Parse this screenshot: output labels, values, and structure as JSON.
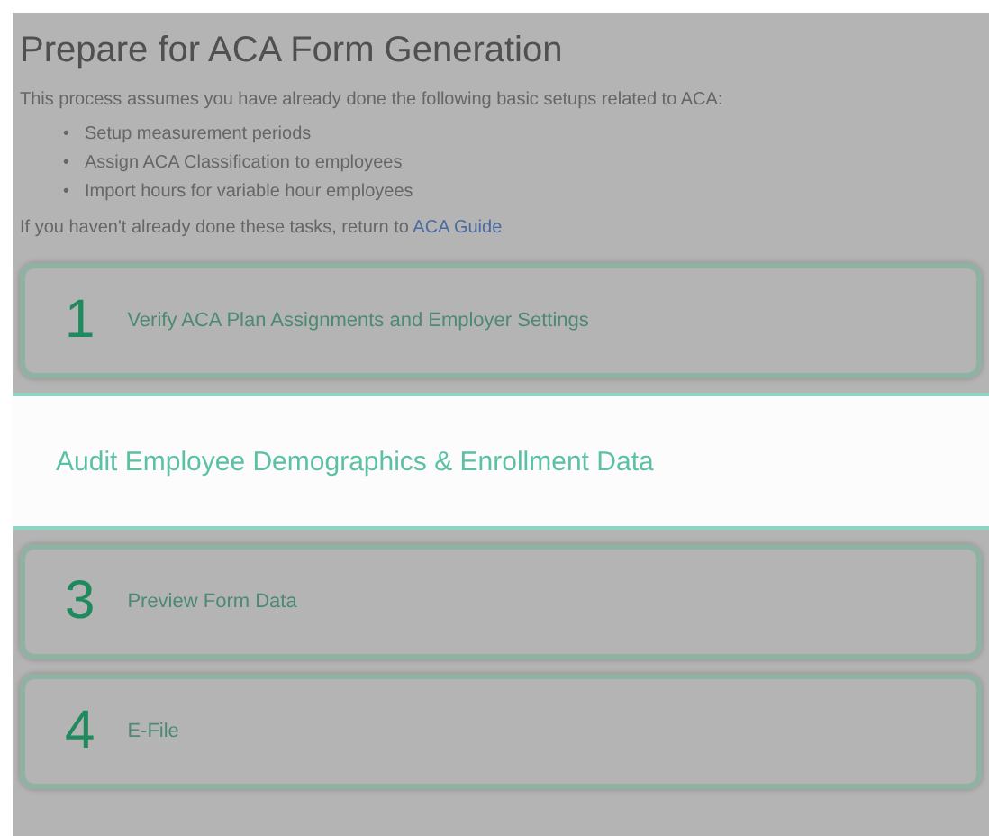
{
  "title": "Prepare for ACA Form Generation",
  "intro": "This process assumes you have already done the following basic setups related to ACA:",
  "prerequisites": [
    {
      "marker": "•",
      "text": "Setup measurement periods"
    },
    {
      "marker": "•",
      "text": "Assign ACA Classification to employees"
    },
    {
      "marker": "•",
      "text": "Import hours for variable hour employees"
    }
  ],
  "guide_note": {
    "text": "If you haven't already done these tasks, return to",
    "link": "ACA Guide"
  },
  "steps": [
    {
      "number": "1",
      "label": "Verify ACA Plan Assignments and Employer Settings",
      "highlighted": false
    },
    {
      "label": "Audit Employee Demographics & Enrollment Data",
      "highlighted": true
    },
    {
      "number": "3",
      "label": "Preview Form Data",
      "highlighted": false
    },
    {
      "number": "4",
      "label": "E-File",
      "highlighted": false
    }
  ]
}
